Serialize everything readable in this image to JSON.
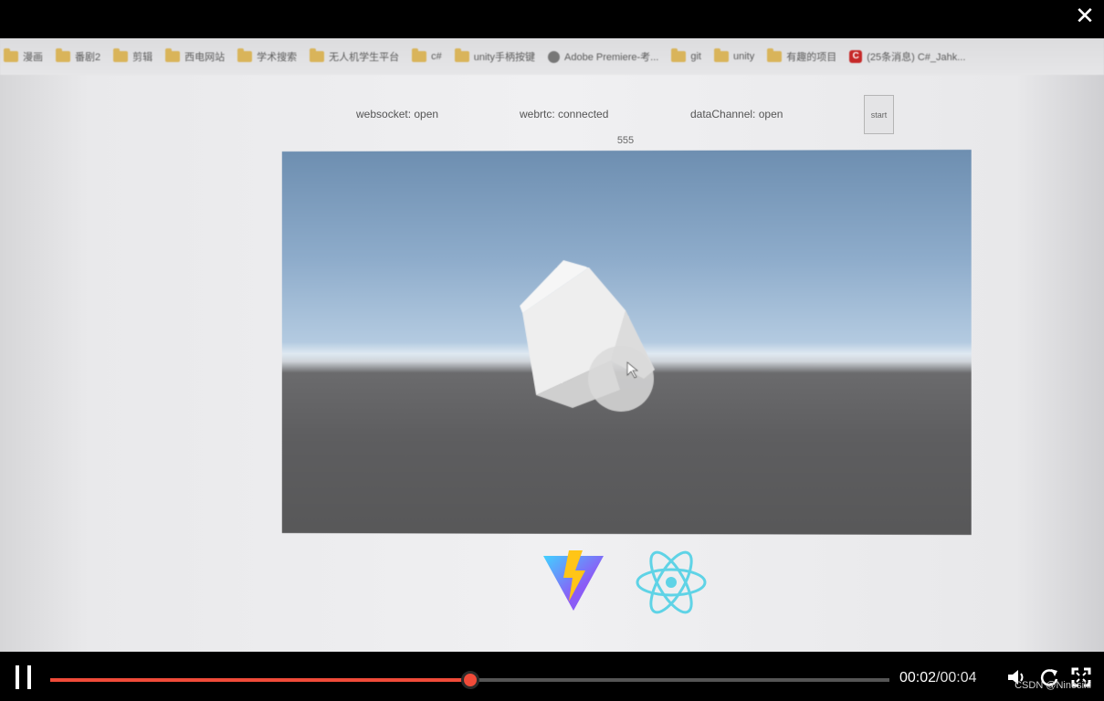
{
  "viewer": {
    "close_label": "✕"
  },
  "bookmarks": [
    {
      "label": "漫画",
      "icon": "folder-icon"
    },
    {
      "label": "番剧2",
      "icon": "folder-icon"
    },
    {
      "label": "剪辑",
      "icon": "folder-icon"
    },
    {
      "label": "西电网站",
      "icon": "folder-icon"
    },
    {
      "label": "学术搜索",
      "icon": "folder-icon"
    },
    {
      "label": "无人机学生平台",
      "icon": "folder-icon"
    },
    {
      "label": "c#",
      "icon": "folder-icon"
    },
    {
      "label": "unity手柄按键",
      "icon": "folder-icon"
    },
    {
      "label": "Adobe Premiere-考...",
      "icon": "site-icon"
    },
    {
      "label": "git",
      "icon": "folder-icon"
    },
    {
      "label": "unity",
      "icon": "folder-icon"
    },
    {
      "label": "有趣的项目",
      "icon": "folder-icon"
    },
    {
      "label": "(25条消息) C#_Jahk...",
      "icon": "csdn-icon"
    }
  ],
  "status": {
    "websocket": "websocket: open",
    "webrtc": "webrtc: connected",
    "datachannel": "dataChannel: open",
    "start_label": "start",
    "counter": "555"
  },
  "player": {
    "current_time": "00:02",
    "separator": "/",
    "duration": "00:04",
    "progress": 0.5,
    "watermark": "CSDN @Ninosiki"
  },
  "colors": {
    "progress": "#f04b39",
    "vite_purple": "#8b5cf6",
    "vite_yellow": "#ffc517",
    "react_cyan": "#5fd3e6"
  }
}
